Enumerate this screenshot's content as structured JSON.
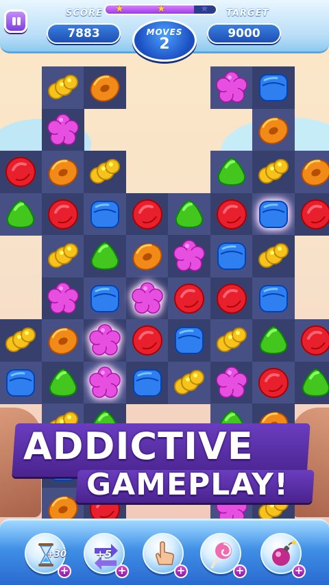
{
  "hud": {
    "score_label": "SCORE",
    "score_value": "7883",
    "target_label": "TARGET",
    "target_value": "9000",
    "moves_label": "MOVES",
    "moves_value": "2",
    "star_progress": 0.8,
    "stars_earned": 2,
    "stars_total": 3
  },
  "promo": {
    "line1": "ADDICTIVE",
    "line2": "GAMEPLAY!"
  },
  "boosters": [
    {
      "name": "hourglass-booster",
      "text": "+30",
      "icon": "hourglass-icon"
    },
    {
      "name": "extra-moves-booster",
      "text": "+5",
      "icon": "arrows-icon"
    },
    {
      "name": "hand-booster",
      "text": "",
      "icon": "pointing-hand-icon"
    },
    {
      "name": "lollipop-booster",
      "text": "",
      "icon": "lollipop-icon"
    },
    {
      "name": "bomb-booster",
      "text": "",
      "icon": "bomb-icon"
    }
  ],
  "colors": {
    "red": "#e8202e",
    "orange": "#f28a18",
    "yellow": "#f7c21c",
    "green": "#43c61e",
    "blue": "#2f7ff0",
    "purple": "#e64fe0"
  },
  "board": {
    "columns": 8,
    "rows": 11,
    "grid": [
      [
        null,
        "yellow",
        "orange",
        null,
        null,
        "purple",
        "blue",
        null
      ],
      [
        null,
        "purple",
        null,
        null,
        null,
        null,
        "orange",
        null
      ],
      [
        "red",
        "orange",
        "yellow",
        null,
        null,
        "green",
        "yellow",
        "orange"
      ],
      [
        "green",
        "red",
        "blue",
        "red",
        "green",
        "red",
        "blue*",
        "red"
      ],
      [
        null,
        "yellow",
        "green",
        "orange",
        "purple",
        "blue",
        "yellow",
        null
      ],
      [
        null,
        "purple",
        "blue",
        "purple*",
        "red",
        "red",
        "blue",
        null
      ],
      [
        "yellow",
        "orange",
        "purple*",
        "red",
        "blue",
        "yellow",
        "green",
        "red"
      ],
      [
        "blue",
        "green",
        "purple*",
        "blue",
        "yellow",
        "purple",
        "red",
        "green"
      ],
      [
        null,
        "yellow",
        "green",
        null,
        null,
        "green",
        "orange",
        null
      ],
      [
        null,
        "blue",
        null,
        null,
        null,
        null,
        null,
        null
      ],
      [
        null,
        "orange",
        "red",
        null,
        null,
        "purple",
        "yellow",
        null
      ]
    ]
  }
}
